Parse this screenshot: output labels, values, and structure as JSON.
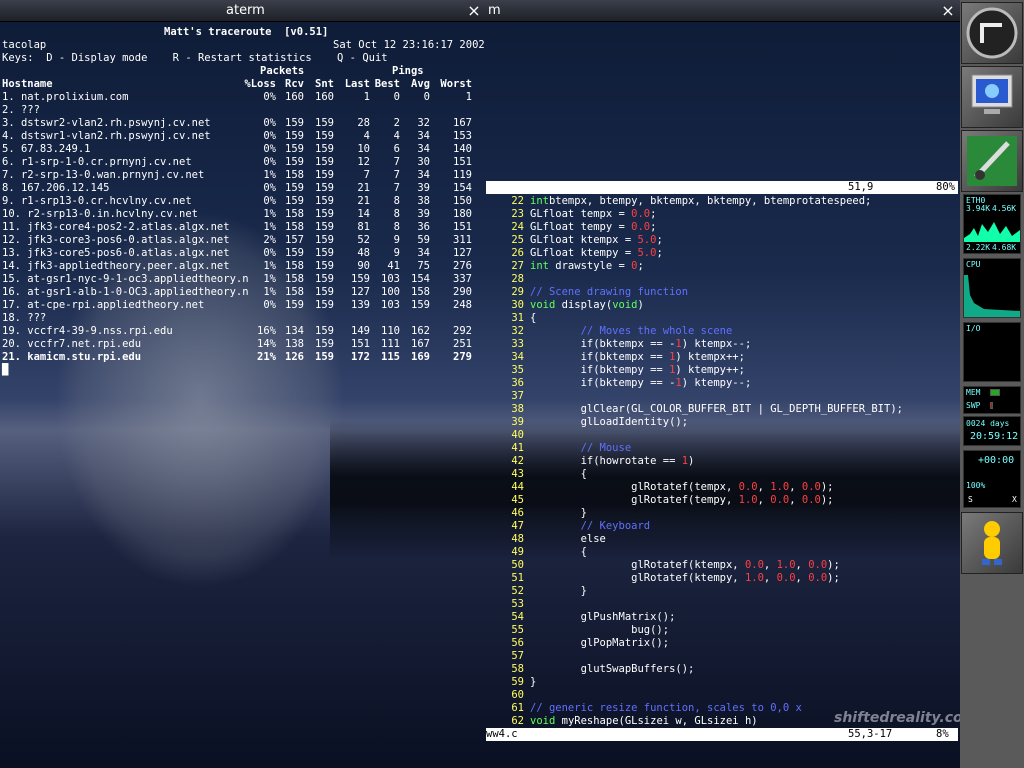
{
  "windows": {
    "left_title": "aterm",
    "right_title": "m",
    "close_glyph": "×"
  },
  "traceroute": {
    "title": "Matt's traceroute  [v0.51]",
    "host": "tacolap",
    "datetime": "Sat Oct 12 23:16:17 2002",
    "keys": "Keys:  D - Display mode    R - Restart statistics    Q - Quit",
    "group_packets": "Packets",
    "group_pings": "Pings",
    "columns": [
      "Hostname",
      "%Loss",
      "Rcv",
      "Snt",
      "Last",
      "Best",
      "Avg",
      "Worst"
    ],
    "hops": [
      [
        "1. nat.prolixium.com",
        "0%",
        "160",
        "160",
        "1",
        "0",
        "0",
        "1"
      ],
      [
        "2. ???",
        "",
        "",
        "",
        "",
        "",
        "",
        ""
      ],
      [
        "3. dstswr2-vlan2.rh.pswynj.cv.net",
        "0%",
        "159",
        "159",
        "28",
        "2",
        "32",
        "167"
      ],
      [
        "4. dstswr1-vlan2.rh.pswynj.cv.net",
        "0%",
        "159",
        "159",
        "4",
        "4",
        "34",
        "153"
      ],
      [
        "5. 67.83.249.1",
        "0%",
        "159",
        "159",
        "10",
        "6",
        "34",
        "140"
      ],
      [
        "6. r1-srp-1-0.cr.prnynj.cv.net",
        "0%",
        "159",
        "159",
        "12",
        "7",
        "30",
        "151"
      ],
      [
        "7. r2-srp-13-0.wan.prnynj.cv.net",
        "1%",
        "158",
        "159",
        "7",
        "7",
        "34",
        "119"
      ],
      [
        "8. 167.206.12.145",
        "0%",
        "159",
        "159",
        "21",
        "7",
        "39",
        "154"
      ],
      [
        "9. r1-srp13-0.cr.hcvlny.cv.net",
        "0%",
        "159",
        "159",
        "21",
        "8",
        "38",
        "150"
      ],
      [
        "10. r2-srp13-0.in.hcvlny.cv.net",
        "1%",
        "158",
        "159",
        "14",
        "8",
        "39",
        "180"
      ],
      [
        "11. jfk3-core4-pos2-2.atlas.algx.net",
        "1%",
        "158",
        "159",
        "81",
        "8",
        "36",
        "151"
      ],
      [
        "12. jfk3-core3-pos6-0.atlas.algx.net",
        "2%",
        "157",
        "159",
        "52",
        "9",
        "59",
        "311"
      ],
      [
        "13. jfk3-core5-pos6-0.atlas.algx.net",
        "0%",
        "159",
        "159",
        "48",
        "9",
        "34",
        "127"
      ],
      [
        "14. jfk3-appliedtheory.peer.algx.net",
        "1%",
        "158",
        "159",
        "90",
        "41",
        "75",
        "276"
      ],
      [
        "15. at-gsr1-nyc-9-1-oc3.appliedtheory.n",
        "1%",
        "158",
        "159",
        "159",
        "103",
        "154",
        "337"
      ],
      [
        "16. at-gsr1-alb-1-0-OC3.appliedtheory.n",
        "1%",
        "158",
        "159",
        "127",
        "100",
        "158",
        "290"
      ],
      [
        "17. at-cpe-rpi.appliedtheory.net",
        "0%",
        "159",
        "159",
        "139",
        "103",
        "159",
        "248"
      ],
      [
        "18. ???",
        "",
        "",
        "",
        "",
        "",
        "",
        ""
      ],
      [
        "19. vccfr4-39-9.nss.rpi.edu",
        "16%",
        "134",
        "159",
        "149",
        "110",
        "162",
        "292"
      ],
      [
        "20. vccfr7.net.rpi.edu",
        "14%",
        "138",
        "159",
        "151",
        "111",
        "167",
        "251"
      ],
      [
        "21. kamicm.stu.rpi.edu",
        "21%",
        "126",
        "159",
        "172",
        "115",
        "169",
        "279"
      ]
    ],
    "cursor": "█"
  },
  "editor": {
    "top_status_pos": "51,9",
    "top_status_pct": "80%",
    "bottom_status_file": "ww4.c",
    "bottom_status_pos": "55,3-17",
    "bottom_status_pct": "8%",
    "lines": [
      {
        "n": "22",
        "segs": [
          [
            "kw",
            "int"
          ],
          [
            "",
            "btempx, btempy, bktempx, bktempy, btemprotatespeed;"
          ]
        ]
      },
      {
        "n": "23",
        "segs": [
          [
            "",
            "GLfloat tempx = "
          ],
          [
            "lit",
            "0.0"
          ],
          [
            "",
            ";"
          ]
        ]
      },
      {
        "n": "24",
        "segs": [
          [
            "",
            "GLfloat tempy = "
          ],
          [
            "lit",
            "0.0"
          ],
          [
            "",
            ";"
          ]
        ]
      },
      {
        "n": "25",
        "segs": [
          [
            "",
            "GLfloat ktempx = "
          ],
          [
            "lit",
            "5.0"
          ],
          [
            "",
            ";"
          ]
        ]
      },
      {
        "n": "26",
        "segs": [
          [
            "",
            "GLfloat ktempy = "
          ],
          [
            "lit",
            "5.0"
          ],
          [
            "",
            ";"
          ]
        ]
      },
      {
        "n": "27",
        "segs": [
          [
            "kw",
            "int"
          ],
          [
            "",
            " drawstyle = "
          ],
          [
            "lit",
            "0"
          ],
          [
            "",
            ";"
          ]
        ]
      },
      {
        "n": "28",
        "segs": []
      },
      {
        "n": "29",
        "segs": [
          [
            "cm",
            "// Scene drawing function"
          ]
        ]
      },
      {
        "n": "30",
        "segs": [
          [
            "kw",
            "void"
          ],
          [
            "",
            " display("
          ],
          [
            "kw",
            "void"
          ],
          [
            "",
            ")"
          ]
        ]
      },
      {
        "n": "31",
        "segs": [
          [
            "",
            "{"
          ]
        ]
      },
      {
        "n": "32",
        "segs": [
          [
            "",
            "        "
          ],
          [
            "cm",
            "// Moves the whole scene"
          ]
        ]
      },
      {
        "n": "33",
        "segs": [
          [
            "",
            "        if(bktempx == -"
          ],
          [
            "lit",
            "1"
          ],
          [
            "",
            ") ktempx--;"
          ]
        ]
      },
      {
        "n": "34",
        "segs": [
          [
            "",
            "        if(bktempx == "
          ],
          [
            "lit",
            "1"
          ],
          [
            "",
            ") ktempx++;"
          ]
        ]
      },
      {
        "n": "35",
        "segs": [
          [
            "",
            "        if(bktempy == "
          ],
          [
            "lit",
            "1"
          ],
          [
            "",
            ") ktempy++;"
          ]
        ]
      },
      {
        "n": "36",
        "segs": [
          [
            "",
            "        if(bktempy == -"
          ],
          [
            "lit",
            "1"
          ],
          [
            "",
            ") ktempy--;"
          ]
        ]
      },
      {
        "n": "37",
        "segs": []
      },
      {
        "n": "38",
        "segs": [
          [
            "",
            "        glClear(GL_COLOR_BUFFER_BIT | GL_DEPTH_BUFFER_BIT);"
          ]
        ]
      },
      {
        "n": "39",
        "segs": [
          [
            "",
            "        glLoadIdentity();"
          ]
        ]
      },
      {
        "n": "40",
        "segs": []
      },
      {
        "n": "41",
        "segs": [
          [
            "",
            "        "
          ],
          [
            "cm",
            "// Mouse"
          ]
        ]
      },
      {
        "n": "42",
        "segs": [
          [
            "",
            "        if(howrotate == "
          ],
          [
            "lit",
            "1"
          ],
          [
            "",
            ")"
          ]
        ]
      },
      {
        "n": "43",
        "segs": [
          [
            "",
            "        {"
          ]
        ]
      },
      {
        "n": "44",
        "segs": [
          [
            "",
            "                glRotatef(tempx, "
          ],
          [
            "lit",
            "0.0"
          ],
          [
            "",
            ", "
          ],
          [
            "lit",
            "1.0"
          ],
          [
            "",
            ", "
          ],
          [
            "lit",
            "0.0"
          ],
          [
            "",
            ");"
          ]
        ]
      },
      {
        "n": "45",
        "segs": [
          [
            "",
            "                glRotatef(tempy, "
          ],
          [
            "lit",
            "1.0"
          ],
          [
            "",
            ", "
          ],
          [
            "lit",
            "0.0"
          ],
          [
            "",
            ", "
          ],
          [
            "lit",
            "0.0"
          ],
          [
            "",
            ");"
          ]
        ]
      },
      {
        "n": "46",
        "segs": [
          [
            "",
            "        }"
          ]
        ]
      },
      {
        "n": "47",
        "segs": [
          [
            "",
            "        "
          ],
          [
            "cm",
            "// Keyboard"
          ]
        ]
      },
      {
        "n": "48",
        "segs": [
          [
            "",
            "        else"
          ]
        ]
      },
      {
        "n": "49",
        "segs": [
          [
            "",
            "        {"
          ]
        ]
      },
      {
        "n": "50",
        "segs": [
          [
            "",
            "                glRotatef(ktempx, "
          ],
          [
            "lit",
            "0.0"
          ],
          [
            "",
            ", "
          ],
          [
            "lit",
            "1.0"
          ],
          [
            "",
            ", "
          ],
          [
            "lit",
            "0.0"
          ],
          [
            "",
            ");"
          ]
        ]
      },
      {
        "n": "51",
        "segs": [
          [
            "",
            "                glRotatef(ktempy, "
          ],
          [
            "lit",
            "1.0"
          ],
          [
            "",
            ", "
          ],
          [
            "lit",
            "0.0"
          ],
          [
            "",
            ", "
          ],
          [
            "lit",
            "0.0"
          ],
          [
            "",
            ");"
          ]
        ]
      },
      {
        "n": "52",
        "segs": [
          [
            "",
            "        }"
          ]
        ]
      },
      {
        "n": "53",
        "segs": []
      },
      {
        "n": "54",
        "segs": [
          [
            "",
            "        glPushMatrix();"
          ]
        ]
      },
      {
        "n": "55",
        "segs": [
          [
            "",
            "                bug();"
          ]
        ]
      },
      {
        "n": "56",
        "segs": [
          [
            "",
            "        glPopMatrix();"
          ]
        ]
      },
      {
        "n": "57",
        "segs": []
      },
      {
        "n": "58",
        "segs": [
          [
            "",
            "        glutSwapBuffers();"
          ]
        ]
      },
      {
        "n": "59",
        "segs": [
          [
            "",
            "}"
          ]
        ]
      },
      {
        "n": "60",
        "segs": []
      },
      {
        "n": "61",
        "segs": [
          [
            "cm",
            "// generic resize function, scales to 0,0 x"
          ]
        ]
      },
      {
        "n": "62",
        "segs": [
          [
            "kw",
            "void"
          ],
          [
            "",
            " myReshape(GLsizei w, GLsizei h)"
          ]
        ]
      }
    ]
  },
  "dock": {
    "net_label": "ETH0",
    "net_in": "3.94K",
    "net_out": "4.56K",
    "net_in2": "2.22K",
    "net_out2": "4.68K",
    "cpu_label": "CPU",
    "io_label": "I/O",
    "mem_label": "MEM",
    "swp_label": "SWP",
    "uptime_days": "0024 days",
    "uptime_time": "20:59:12",
    "timer": "+00:00",
    "battery": "100%",
    "s_label": "S",
    "x_label": "X"
  },
  "watermark": "shiftedreality.com",
  "colors": {
    "keyword": "#60ff60",
    "comment": "#6070ff",
    "literal": "#ff4040",
    "lineno": "#ffff60"
  }
}
